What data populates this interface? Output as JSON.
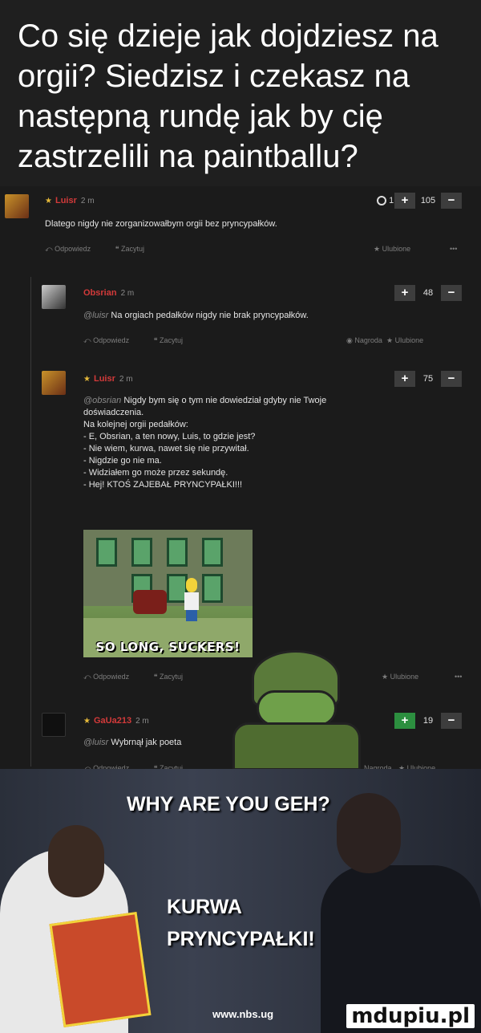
{
  "headline": "Co się dzieje jak dojdziesz na orgii? Siedzisz i czekasz na następną rundę jak by cię zastrzelili na paintballu?",
  "labels": {
    "reply": "Odpowiedz",
    "quote": "Zacytuj",
    "favorite": "Ulubione",
    "award": "Nagroda",
    "more": "•••"
  },
  "comments": [
    {
      "author": "Luisr",
      "ago": "2 m",
      "attach_count": "1",
      "score": "105",
      "text": "Dlatego nigdy nie zorganizowałbym orgii bez pryncypałków."
    },
    {
      "author": "Obsrian",
      "ago": "2 m",
      "mention": "@luisr",
      "score": "48",
      "text": "Na orgiach pedałków nigdy nie brak pryncypałków."
    },
    {
      "author": "Luisr",
      "ago": "2 m",
      "mention": "@obsrian",
      "score": "75",
      "text_lines": [
        "Nigdy bym się o tym nie dowiedział gdyby nie Twoje",
        "doświadczenia.",
        "Na kolejnej orgii pedałków:",
        "- E, Obsrian, a ten nowy, Luis, to gdzie jest?",
        "- Nie wiem, kurwa, nawet się nie przywitał.",
        "- Nigdzie go nie ma.",
        "- Widziałem go może przez sekundę.",
        "- Hej! KTOŚ ZAJEBAŁ PRYNCYPAŁKI!!!"
      ],
      "image_caption": "SO LONG, SUCKERS!"
    },
    {
      "author": "GaUa213",
      "ago": "2 m",
      "mention": "@luisr",
      "score": "19",
      "text": "Wybrnął jak poeta"
    }
  ],
  "bottom": {
    "line1": "WHY ARE YOU GEH?",
    "line2": "KURWA",
    "line3": "PRYNCYPAŁKI!",
    "tv_url": "www.nbs.ug",
    "watermark": "mdupiu.pl"
  },
  "colors": {
    "author": "#d33a3a",
    "star": "#e5b93a",
    "background": "#1b1b1b",
    "upvote_active": "#2c8f3f"
  }
}
